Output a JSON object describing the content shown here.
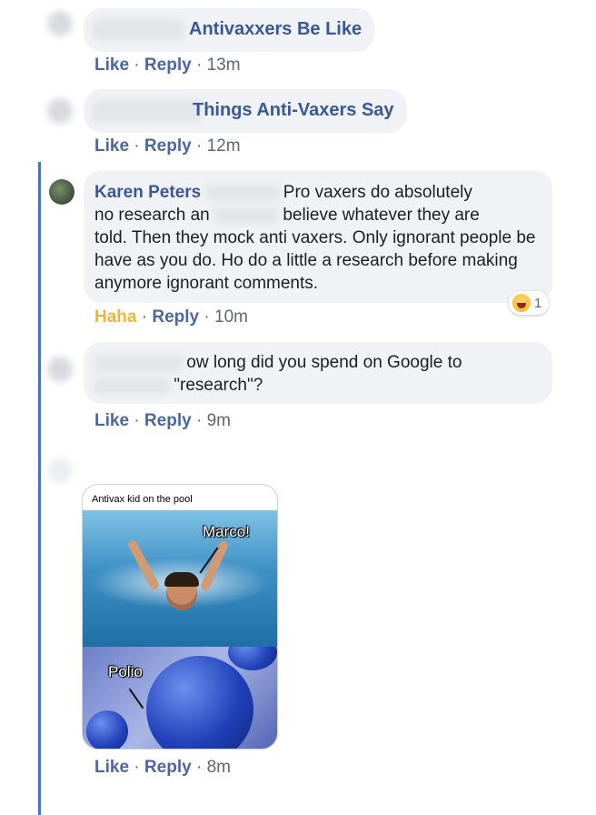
{
  "comments": [
    {
      "shared_title": "Antivaxxers Be Like",
      "actions": {
        "like": "Like",
        "reply": "Reply",
        "time": "13m"
      }
    },
    {
      "shared_title": "Things Anti-Vaxers Say",
      "actions": {
        "like": "Like",
        "reply": "Reply",
        "time": "12m"
      }
    },
    {
      "author": "Karen Peters",
      "text_line1": "Pro vaxers do absolutely",
      "text_line2_a": "no research an",
      "text_line2_b": "believe whatever they are",
      "text_rest": "told. Then they mock anti vaxers. Only ignorant people be have as you do. Ho do a little a research before making anymore ignorant comments.",
      "reaction_count": "1",
      "actions": {
        "haha": "Haha",
        "reply": "Reply",
        "time": "10m"
      }
    },
    {
      "text_line1": "ow long did you spend on Google to",
      "text_line2": "\"research\"?",
      "actions": {
        "like": "Like",
        "reply": "Reply",
        "time": "9m"
      }
    },
    {
      "meme": {
        "caption": "Antivax kid on the pool",
        "label_top": "Marco!",
        "label_bottom": "Polio"
      },
      "actions": {
        "like": "Like",
        "reply": "Reply",
        "time": "8m"
      }
    }
  ],
  "separator": "·",
  "colors": {
    "thread_line": "#3b78c2",
    "link": "#385898",
    "haha": "#f0b43c",
    "bubble": "#f0f2f5"
  }
}
